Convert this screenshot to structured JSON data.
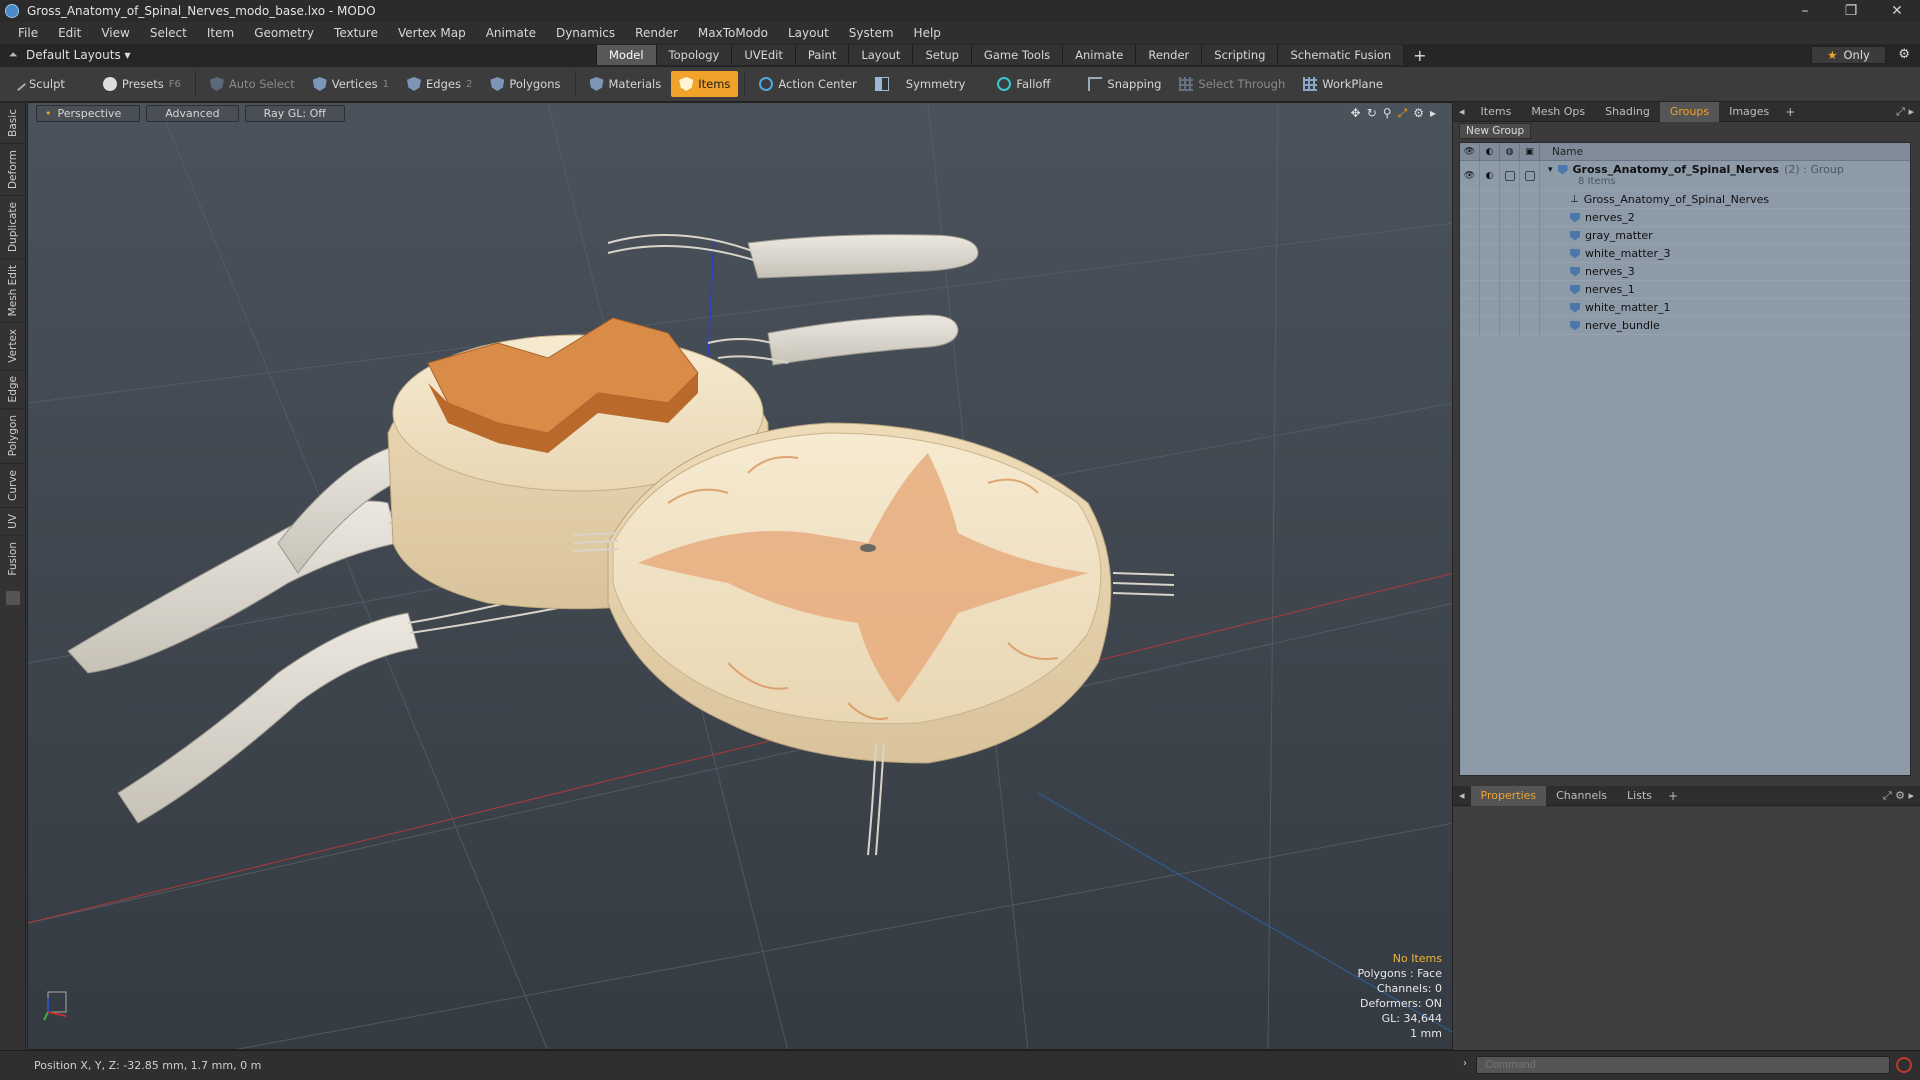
{
  "window": {
    "title": "Gross_Anatomy_of_Spinal_Nerves_modo_base.lxo - MODO"
  },
  "menu": [
    "File",
    "Edit",
    "View",
    "Select",
    "Item",
    "Geometry",
    "Texture",
    "Vertex Map",
    "Animate",
    "Dynamics",
    "Render",
    "MaxToModo",
    "Layout",
    "System",
    "Help"
  ],
  "layout": {
    "selector": "Default Layouts ▾",
    "tabs": [
      "Model",
      "Topology",
      "UVEdit",
      "Paint",
      "Layout",
      "Setup",
      "Game Tools",
      "Animate",
      "Render",
      "Scripting",
      "Schematic Fusion"
    ],
    "active_tab": "Model",
    "only_label": "Only"
  },
  "toolbar": {
    "sculpt": "Sculpt",
    "presets": "Presets",
    "presets_key": "F6",
    "auto_select": "Auto Select",
    "vertices": "Vertices",
    "vertices_key": "1",
    "edges": "Edges",
    "edges_key": "2",
    "polygons": "Polygons",
    "materials": "Materials",
    "items": "Items",
    "action_center": "Action Center",
    "symmetry": "Symmetry",
    "falloff": "Falloff",
    "snapping": "Snapping",
    "select_through": "Select Through",
    "workplane": "WorkPlane"
  },
  "left_tabs": [
    "Basic",
    "Deform",
    "Duplicate",
    "Mesh Edit",
    "Vertex",
    "Edge",
    "Polygon",
    "Curve",
    "UV",
    "Fusion"
  ],
  "viewport": {
    "view": "Perspective",
    "shading": "Advanced",
    "raygl": "Ray GL: Off",
    "status": {
      "items": "No Items",
      "polygons": "Polygons : Face",
      "channels": "Channels: 0",
      "deformers": "Deformers: ON",
      "gl": "GL: 34,644",
      "unit": "1 mm"
    }
  },
  "groups_panel": {
    "tabs": [
      "Items",
      "Mesh Ops",
      "Shading",
      "Groups",
      "Images"
    ],
    "active_tab": "Groups",
    "new_group": "New Group",
    "name_header": "Name",
    "group": {
      "name": "Gross_Anatomy_of_Spinal_Nerves",
      "tag": "(2) : Group",
      "count": "8 Items"
    },
    "items": [
      "Gross_Anatomy_of_Spinal_Nerves",
      "nerves_2",
      "gray_matter",
      "white_matter_3",
      "nerves_3",
      "nerves_1",
      "white_matter_1",
      "nerve_bundle"
    ]
  },
  "props_panel": {
    "tabs": [
      "Properties",
      "Channels",
      "Lists"
    ],
    "active_tab": "Properties"
  },
  "statusbar": {
    "position": "Position X, Y, Z:  -32.85 mm, 1.7 mm, 0 m",
    "command_placeholder": "Command"
  }
}
